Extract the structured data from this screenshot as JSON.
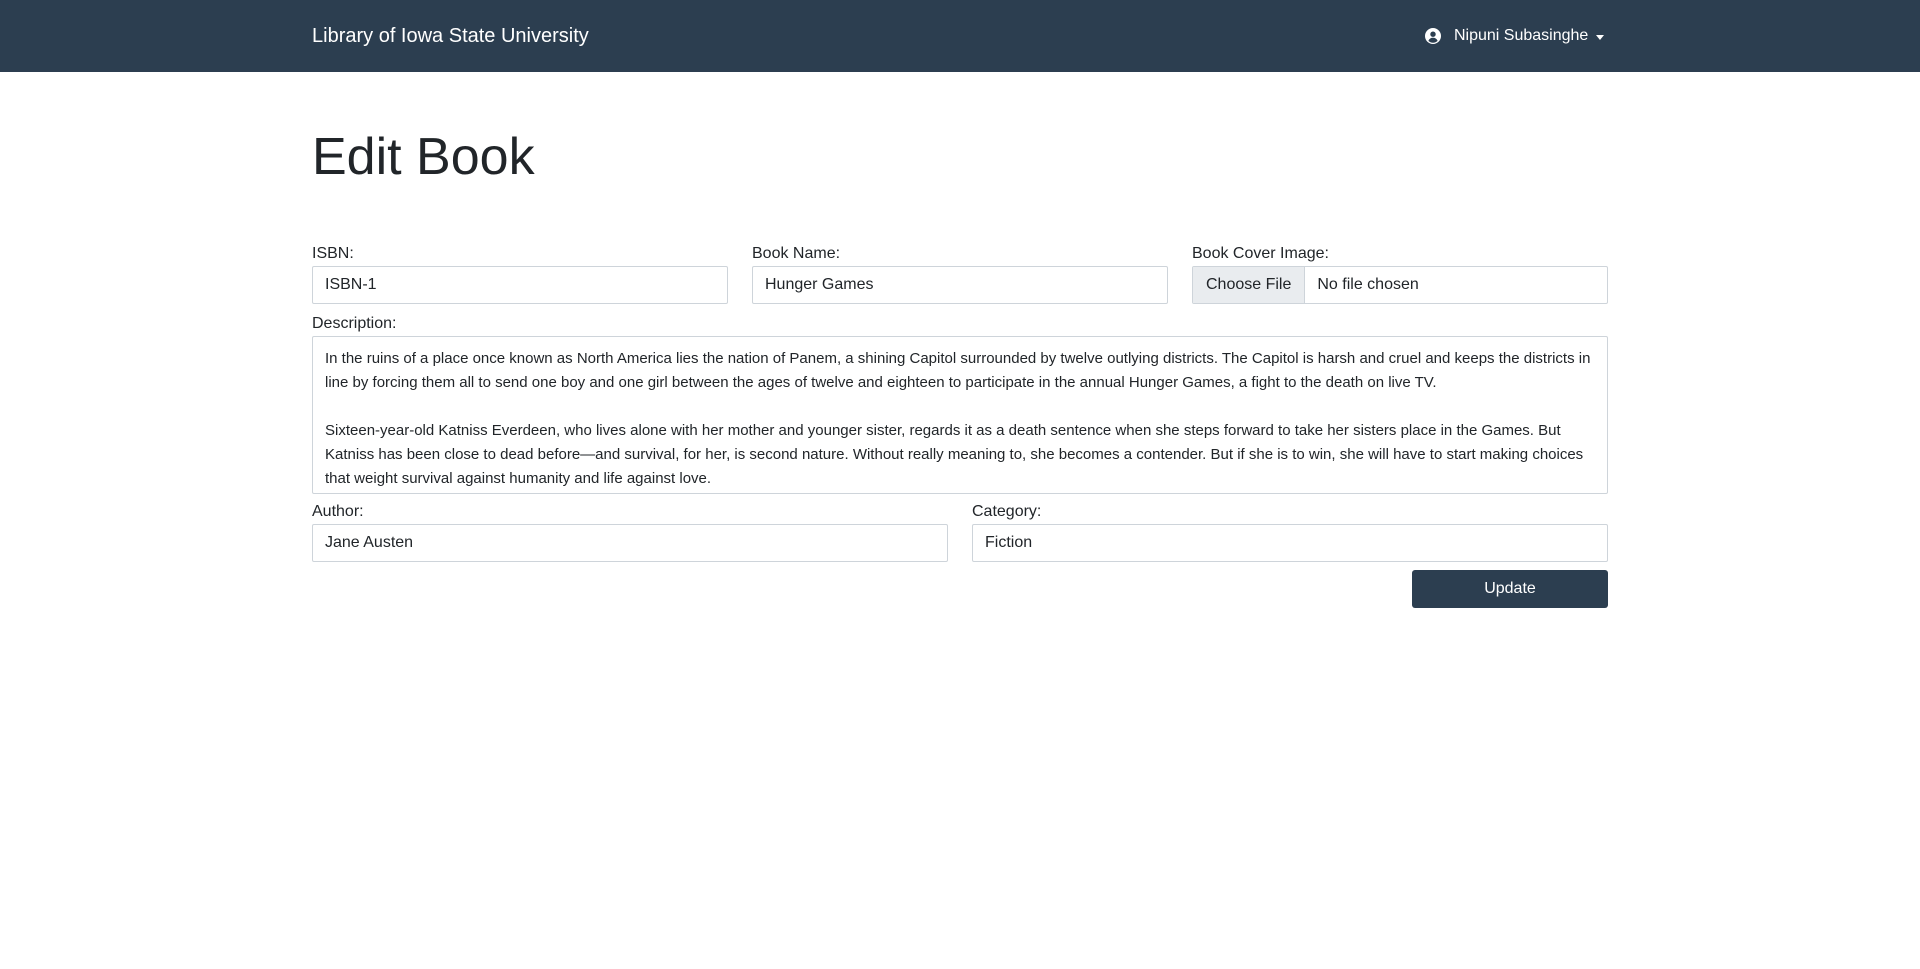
{
  "header": {
    "brand": "Library of Iowa State University",
    "user_name": "Nipuni Subasinghe",
    "user_icon": "user-circle-icon",
    "bg_color": "#2c3e50"
  },
  "page": {
    "title": "Edit Book"
  },
  "form": {
    "isbn": {
      "label": "ISBN:",
      "value": "ISBN-1"
    },
    "book_name": {
      "label": "Book Name:",
      "value": "Hunger Games"
    },
    "cover_image": {
      "label": "Book Cover Image:",
      "button": "Choose File",
      "status": "No file chosen"
    },
    "description": {
      "label": "Description:",
      "paragraph_1": "In the ruins of a place once known as North America lies the nation of Panem, a shining Capitol surrounded by twelve outlying districts. The Capitol is harsh and cruel and keeps the districts in line by forcing them all to send one boy and one girl between the ages of twelve and eighteen to participate in the annual Hunger Games, a fight to the death on live TV.",
      "paragraph_2": "Sixteen-year-old Katniss Everdeen, who lives alone with her mother and younger sister, regards it as a death sentence when she steps forward to take her sisters place in the Games. But Katniss has been close to dead before—and survival, for her, is second nature. Without really meaning to, she becomes a contender. But if she is to win, she will have to start making choices that weight survival against humanity and life against love."
    },
    "author": {
      "label": "Author:",
      "value": "Jane Austen"
    },
    "category": {
      "label": "Category:",
      "value": "Fiction"
    },
    "submit_label": "Update"
  }
}
